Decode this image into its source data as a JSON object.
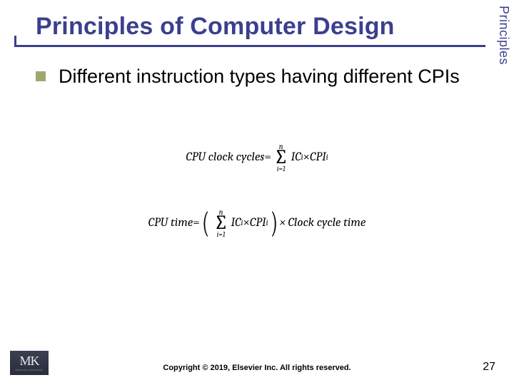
{
  "header": {
    "title": "Principles of Computer Design",
    "side_tab": "Principles"
  },
  "content": {
    "bullet": "Different instruction types having different CPIs"
  },
  "formula1": {
    "lhs": "CPU clock cycles",
    "eq": " = ",
    "sum_top": "n",
    "sum_bot": "i=1",
    "term_a": "IC",
    "term_a_sub": "i",
    "times": " × ",
    "term_b": "CPI",
    "term_b_sub": "i"
  },
  "formula2": {
    "lhs": "CPU time",
    "eq": " = ",
    "sum_top": "n",
    "sum_bot": "i=1",
    "term_a": "IC",
    "term_a_sub": "i",
    "times": " × ",
    "term_b": "CPI",
    "term_b_sub": "i",
    "tail": " × Clock cycle time"
  },
  "footer": {
    "copyright": "Copyright © 2019, Elsevier Inc. All rights reserved.",
    "page": "27",
    "logo_main": "MK",
    "logo_sub": "MORGAN KAUFMANN"
  }
}
